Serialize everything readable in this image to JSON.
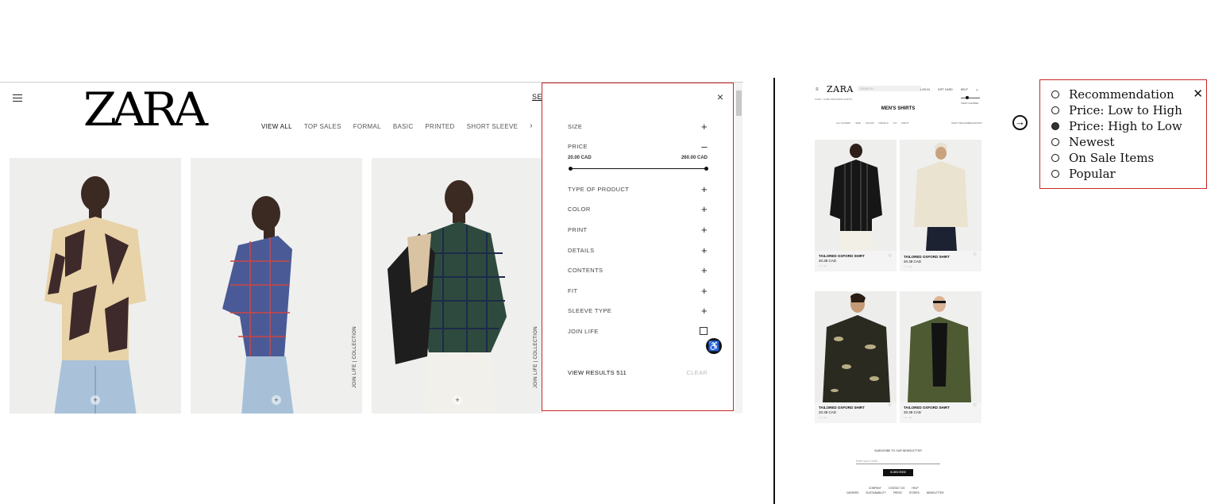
{
  "left": {
    "logo": "ZARA",
    "search_link": "SEA",
    "categories": [
      "VIEW ALL",
      "TOP SALES",
      "FORMAL",
      "BASIC",
      "PRINTED",
      "SHORT SLEEVE"
    ],
    "join_life_label": "JOIN LIFE | COLLECTION",
    "add_icon": "+",
    "filter": {
      "rows": {
        "size": "SIZE",
        "price": "PRICE",
        "type": "TYPE OF PRODUCT",
        "color": "COLOR",
        "print": "PRINT",
        "details": "DETAILS",
        "contents": "CONTENTS",
        "fit": "FIT",
        "sleeve": "SLEEVE TYPE",
        "join_life": "JOIN LIFE"
      },
      "price_min": "20.00 CAD",
      "price_max": "260.00 CAD",
      "view_results": "VIEW RESULTS 511",
      "clear": "CLEAR",
      "expand_sign": "+",
      "collapse_sign": "–",
      "close": "×"
    }
  },
  "mini": {
    "logo": "ZARA",
    "search_placeholder": "SEARCH",
    "links": [
      "LOG IN",
      "GIFT CARD",
      "HELP"
    ],
    "breadcrumb": "CASH / CARE PROGRAM SHIRTS",
    "title": "MEN'S SHIRTS",
    "view_label": "VIEW CHANNEL",
    "filters": [
      "ALL FILTERS",
      "SIZE",
      "COLOR",
      "DETAILS",
      "FIT",
      "PRINT"
    ],
    "sort_label": "SORT: RECOMMENDATION",
    "products": [
      {
        "name": "TAILORED OXFORD SHIRT",
        "price": "20.38 CAD",
        "swatch": "○○○ +2"
      },
      {
        "name": "TAILORED OXFORD SHIRT",
        "price": "20.38 CAD",
        "swatch": "○○○ +2"
      },
      {
        "name": "TAILORED OXFORD SHIRT",
        "price": "20.38 CAD",
        "swatch": "○○○ +2"
      },
      {
        "name": "TAILORED OXFORD SHIRT",
        "price": "20.38 CAD",
        "swatch": "○○○ +2"
      }
    ],
    "newsletter": "SUBSCRIBE TO OUR NEWSLETTER",
    "email_placeholder": "Enter your e-mail",
    "subscribe": "SUBSCRIBE",
    "footer_row1": [
      "COMPANY",
      "CONTACT US",
      "HELP"
    ],
    "footer_row2": [
      "CAREERS",
      "SUSTAINABILITY",
      "PRESS",
      "STORES",
      "NEWSLETTER"
    ]
  },
  "sort": {
    "options": [
      "Recommendation",
      "Price: Low to High",
      "Price: High to Low",
      "Newest",
      "On Sale Items",
      "Popular"
    ],
    "selected": "Price: High to Low",
    "close": "✕",
    "arrow": "→"
  }
}
